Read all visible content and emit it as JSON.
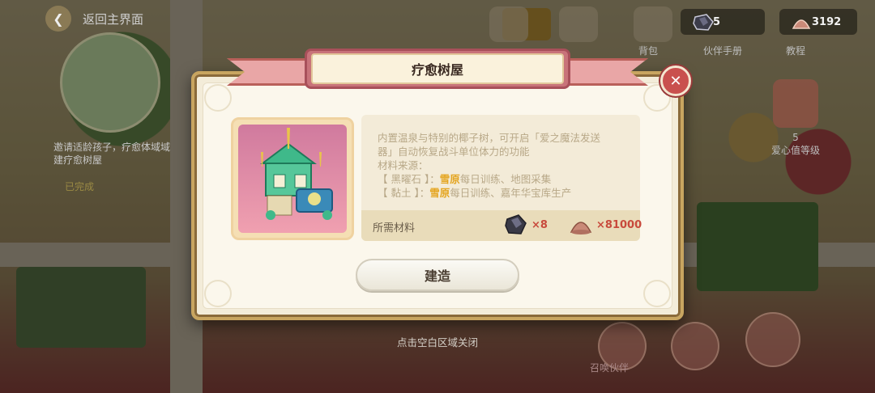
{
  "background": {
    "back_label": "返回主界面",
    "quest_text": "邀请适龄孩子，疗愈体域域建疗愈树屋",
    "quest_reward": "已完成",
    "nav": [
      {
        "name": "bag",
        "label": "背包"
      },
      {
        "name": "partner-handbook",
        "label": "伙伴手册"
      },
      {
        "name": "tutorial",
        "label": "教程"
      }
    ],
    "side_label": "5\n爱心值等级",
    "bottom_label": "召唤伙伴"
  },
  "resources": {
    "obsidian_count": "5",
    "clay_count": "3192"
  },
  "dialog": {
    "title": "疗愈树屋",
    "description_lines": [
      "内置温泉与特别的椰子树，可开启「爱之魔法发送",
      "器」自动恢复战斗单位体力的功能",
      "材料来源："
    ],
    "source1": {
      "prefix": "【 黑曜石 】：",
      "place": "雪原",
      "rest": "每日训练、地图采集"
    },
    "source2": {
      "prefix": "【 黏土 】：",
      "place": "雪原",
      "rest": "每日训练、嘉年华宝库生产"
    },
    "materials_label": "所需材料",
    "material1_count": "×8",
    "material2_count": "×81000",
    "build_label": "建造",
    "close_hint": "点击空白区域关闭"
  },
  "colors": {
    "highlight": "#e4a520",
    "count_red": "#c84a3c",
    "ribbon": "#c8737a",
    "panel_border": "#c8a560"
  },
  "icons": {
    "close": "close-icon",
    "obsidian": "obsidian-icon",
    "clay": "clay-icon",
    "back": "back-arrow-icon"
  }
}
